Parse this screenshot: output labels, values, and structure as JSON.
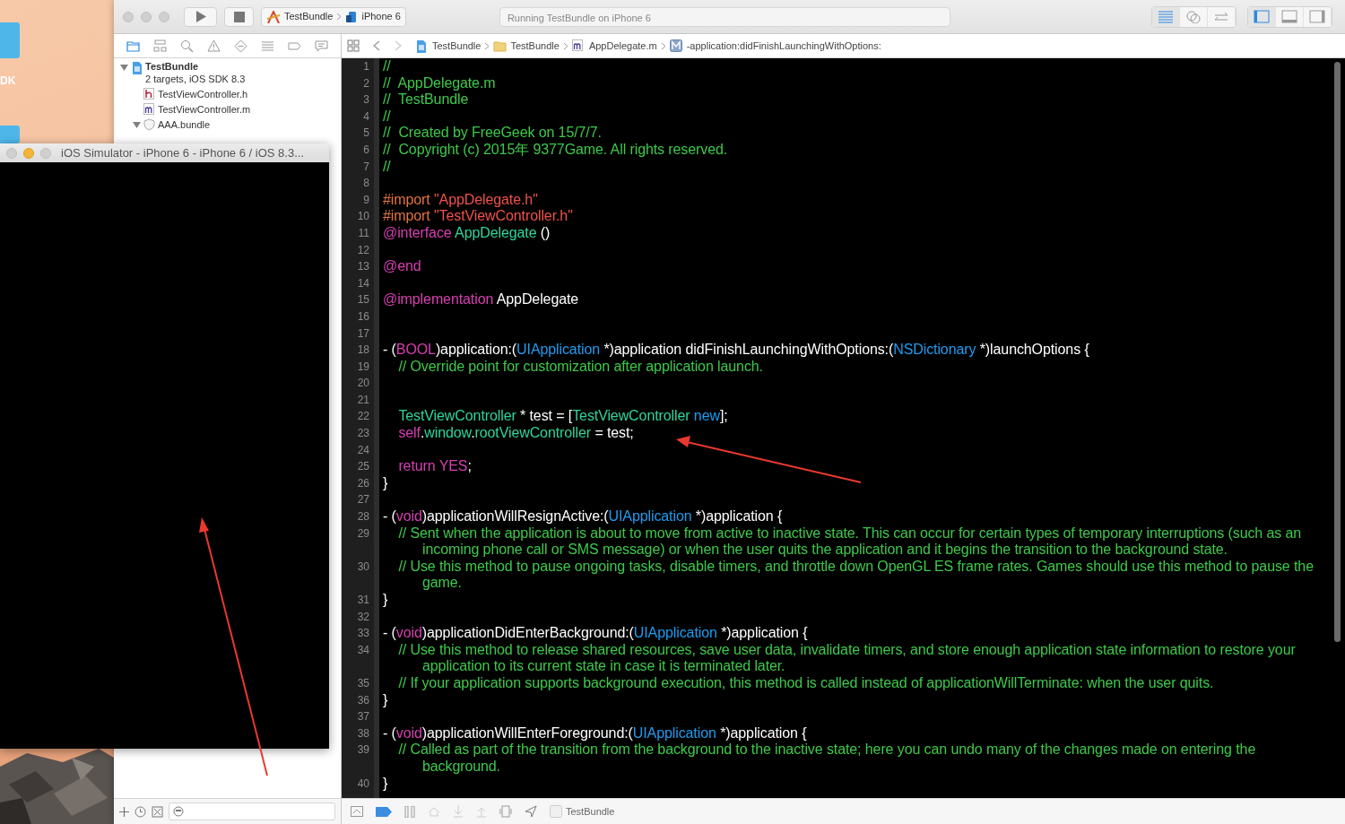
{
  "desktop": {
    "label": "DK"
  },
  "toolbar": {
    "scheme": "TestBundle",
    "device": "iPhone 6",
    "activity": "Running TestBundle on iPhone 6",
    "editor_modes": [
      {
        "kind": "standard",
        "selected": true
      },
      {
        "kind": "assistant",
        "selected": false
      },
      {
        "kind": "version",
        "selected": false
      }
    ],
    "panels": [
      {
        "kind": "navigator",
        "selected": true
      },
      {
        "kind": "debug",
        "selected": false
      },
      {
        "kind": "utilities",
        "selected": false
      }
    ]
  },
  "navigator": {
    "tabs": [
      {
        "kind": "project",
        "selected": true
      },
      {
        "kind": "symbol",
        "selected": false
      },
      {
        "kind": "find",
        "selected": false
      },
      {
        "kind": "issue",
        "selected": false
      },
      {
        "kind": "test",
        "selected": false
      },
      {
        "kind": "debug",
        "selected": false
      },
      {
        "kind": "breakpoint",
        "selected": false
      },
      {
        "kind": "report",
        "selected": false
      }
    ],
    "tree": [
      {
        "kind": "project",
        "name": "TestBundle",
        "subtitle": "2 targets, iOS SDK 8.3",
        "expanded": true,
        "children": [
          {
            "kind": "header",
            "name": "TestViewController.h"
          },
          {
            "kind": "source",
            "name": "TestViewController.m"
          },
          {
            "kind": "bundle",
            "name": "AAA.bundle",
            "expanded": true
          }
        ]
      }
    ]
  },
  "jump_bar": [
    {
      "kind": "project",
      "text": "TestBundle"
    },
    {
      "kind": "folder",
      "text": "TestBundle"
    },
    {
      "kind": "source",
      "text": "AppDelegate.m"
    },
    {
      "kind": "method",
      "text": "-application:didFinishLaunchingWithOptions:"
    }
  ],
  "code": [
    {
      "number": "1",
      "tokens": [
        {
          "kind": "comment",
          "text": "//"
        }
      ]
    },
    {
      "number": "2",
      "tokens": [
        {
          "kind": "comment",
          "text": "//  AppDelegate.m"
        }
      ]
    },
    {
      "number": "3",
      "tokens": [
        {
          "kind": "comment",
          "text": "//  TestBundle"
        }
      ]
    },
    {
      "number": "4",
      "tokens": [
        {
          "kind": "comment",
          "text": "//"
        }
      ]
    },
    {
      "number": "5",
      "tokens": [
        {
          "kind": "comment",
          "text": "//  Created by FreeGeek on 15/7/7."
        }
      ]
    },
    {
      "number": "6",
      "tokens": [
        {
          "kind": "comment",
          "text": "//  Copyright (c) 2015年 9377Game. All rights reserved."
        }
      ]
    },
    {
      "number": "7",
      "tokens": [
        {
          "kind": "comment",
          "text": "//"
        }
      ]
    },
    {
      "number": "8"
    },
    {
      "number": "9",
      "tokens": [
        {
          "kind": "directive",
          "text": "#import "
        },
        {
          "kind": "string",
          "text": "\"AppDelegate.h\""
        }
      ]
    },
    {
      "number": "10",
      "tokens": [
        {
          "kind": "directive",
          "text": "#import "
        },
        {
          "kind": "string",
          "text": "\"TestViewController.h\""
        }
      ]
    },
    {
      "number": "11",
      "tokens": [
        {
          "kind": "keyword",
          "text": "@interface"
        },
        {
          "kind": "project",
          "text": " AppDelegate"
        },
        {
          "kind": "plain",
          "text": " ()"
        }
      ]
    },
    {
      "number": "12"
    },
    {
      "number": "13",
      "tokens": [
        {
          "kind": "keyword",
          "text": "@end"
        }
      ]
    },
    {
      "number": "14"
    },
    {
      "number": "15",
      "tokens": [
        {
          "kind": "keyword",
          "text": "@implementation"
        },
        {
          "kind": "plain",
          "text": " AppDelegate"
        }
      ]
    },
    {
      "number": "16"
    },
    {
      "number": "17"
    },
    {
      "number": "18",
      "tokens": [
        {
          "kind": "plain",
          "text": "- ("
        },
        {
          "kind": "keyword",
          "text": "BOOL"
        },
        {
          "kind": "plain",
          "text": ")application:("
        },
        {
          "kind": "class",
          "text": "UIApplication"
        },
        {
          "kind": "plain",
          "text": " *)application didFinishLaunchingWithOptions:("
        },
        {
          "kind": "class",
          "text": "NSDictionary"
        },
        {
          "kind": "plain",
          "text": " *)launchOptions {"
        }
      ]
    },
    {
      "number": "19",
      "tokens": [
        {
          "kind": "comment",
          "text": "    // Override point for customization after application launch."
        }
      ]
    },
    {
      "number": "20"
    },
    {
      "number": "21"
    },
    {
      "number": "22",
      "tokens": [
        {
          "kind": "project",
          "text": "    TestViewController"
        },
        {
          "kind": "plain",
          "text": " * test = ["
        },
        {
          "kind": "project",
          "text": "TestViewController"
        },
        {
          "kind": "class",
          "text": " new"
        },
        {
          "kind": "plain",
          "text": "];"
        }
      ]
    },
    {
      "number": "23",
      "tokens": [
        {
          "kind": "keyword",
          "text": "    self"
        },
        {
          "kind": "plain",
          "text": "."
        },
        {
          "kind": "project",
          "text": "window"
        },
        {
          "kind": "plain",
          "text": "."
        },
        {
          "kind": "project",
          "text": "rootViewController"
        },
        {
          "kind": "plain",
          "text": " = test;"
        }
      ]
    },
    {
      "number": "24"
    },
    {
      "number": "25",
      "tokens": [
        {
          "kind": "keyword",
          "text": "    return"
        },
        {
          "kind": "keyword",
          "text": " YES"
        },
        {
          "kind": "plain",
          "text": ";"
        }
      ]
    },
    {
      "number": "26",
      "tokens": [
        {
          "kind": "plain",
          "text": "}"
        }
      ]
    },
    {
      "number": "27"
    },
    {
      "number": "28",
      "tokens": [
        {
          "kind": "plain",
          "text": "- ("
        },
        {
          "kind": "keyword",
          "text": "void"
        },
        {
          "kind": "plain",
          "text": ")applicationWillResignActive:("
        },
        {
          "kind": "class",
          "text": "UIApplication"
        },
        {
          "kind": "plain",
          "text": " *)application {"
        }
      ]
    },
    {
      "number": "29",
      "tokens": [
        {
          "kind": "comment",
          "text": "    // Sent when the application is about to move from active to inactive state. This can occur for certain types of temporary interruptions (such as an incoming phone call or SMS message) or when the user quits the application and it begins the transition to the background state."
        }
      ]
    },
    {
      "number": "30",
      "tokens": [
        {
          "kind": "comment",
          "text": "    // Use this method to pause ongoing tasks, disable timers, and throttle down OpenGL ES frame rates. Games should use this method to pause the game."
        }
      ]
    },
    {
      "number": "31",
      "tokens": [
        {
          "kind": "plain",
          "text": "}"
        }
      ]
    },
    {
      "number": "32"
    },
    {
      "number": "33",
      "tokens": [
        {
          "kind": "plain",
          "text": "- ("
        },
        {
          "kind": "keyword",
          "text": "void"
        },
        {
          "kind": "plain",
          "text": ")applicationDidEnterBackground:("
        },
        {
          "kind": "class",
          "text": "UIApplication"
        },
        {
          "kind": "plain",
          "text": " *)application {"
        }
      ]
    },
    {
      "number": "34",
      "tokens": [
        {
          "kind": "comment",
          "text": "    // Use this method to release shared resources, save user data, invalidate timers, and store enough application state information to restore your application to its current state in case it is terminated later."
        }
      ]
    },
    {
      "number": "35",
      "tokens": [
        {
          "kind": "comment",
          "text": "    // If your application supports background execution, this method is called instead of applicationWillTerminate: when the user quits."
        }
      ]
    },
    {
      "number": "36",
      "tokens": [
        {
          "kind": "plain",
          "text": "}"
        }
      ]
    },
    {
      "number": "37"
    },
    {
      "number": "38",
      "tokens": [
        {
          "kind": "plain",
          "text": "- ("
        },
        {
          "kind": "keyword",
          "text": "void"
        },
        {
          "kind": "plain",
          "text": ")applicationWillEnterForeground:("
        },
        {
          "kind": "class",
          "text": "UIApplication"
        },
        {
          "kind": "plain",
          "text": " *)application {"
        }
      ]
    },
    {
      "number": "39",
      "tokens": [
        {
          "kind": "comment",
          "text": "    // Called as part of the transition from the background to the inactive state; here you can undo many of the changes made on entering the background."
        }
      ]
    },
    {
      "number": "40",
      "tokens": [
        {
          "kind": "plain",
          "text": "}"
        }
      ]
    }
  ],
  "debug_bar": {
    "breakpoints_active": true,
    "target": "TestBundle"
  },
  "simulator": {
    "title": "iOS Simulator - iPhone 6 - iPhone 6 / iOS 8.3..."
  }
}
